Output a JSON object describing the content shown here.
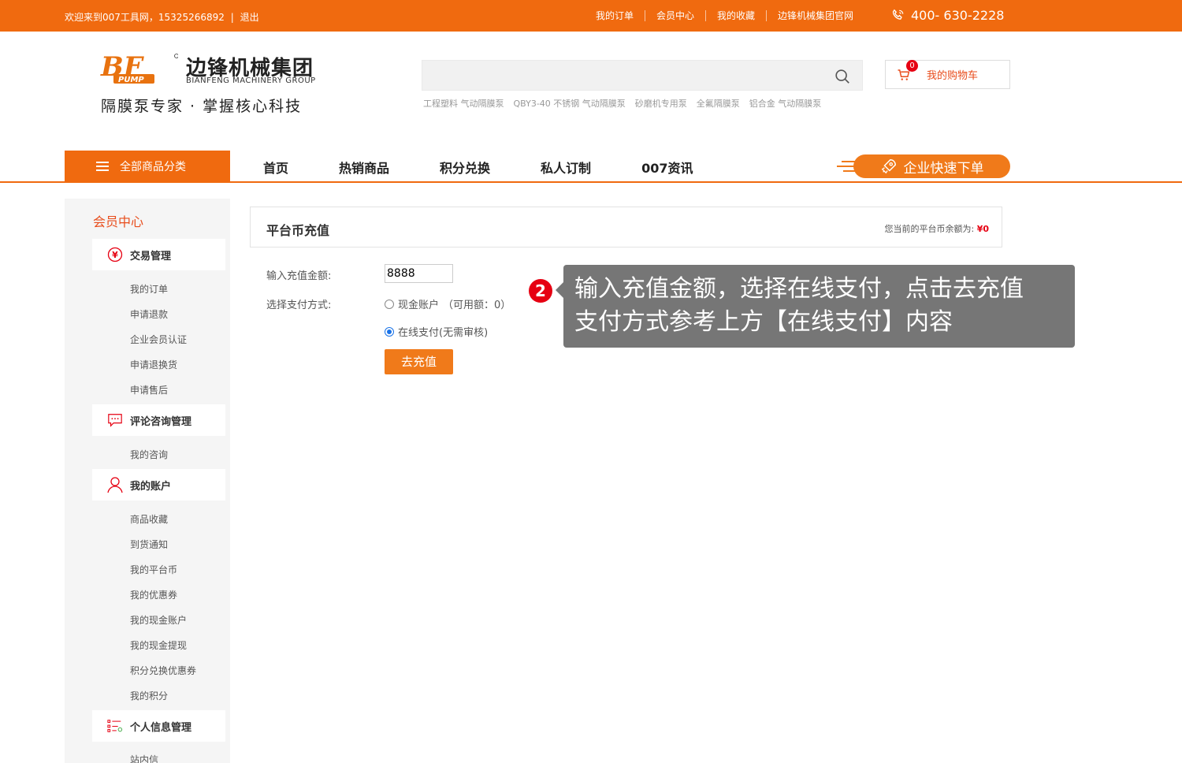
{
  "topbar": {
    "welcome": "欢迎来到007工具网，15325266892",
    "divider": "|",
    "logout": "退出",
    "links": [
      "我的订单",
      "会员中心",
      "我的收藏",
      "边锋机械集团官网"
    ],
    "phone": "400- 630-2228"
  },
  "logo": {
    "mark": "BF",
    "mark_sub": "PUMP",
    "name_cn": "边锋机械集团",
    "name_en": "BIANFENG MACHINERY GROUP",
    "slogan": "隔膜泵专家 · 掌握核心科技"
  },
  "search": {
    "hotwords": [
      "工程塑料 气动隔膜泵",
      "QBY3-40 不锈钢 气动隔膜泵",
      "砂磨机专用泵",
      "全氟隔膜泵",
      "铝合金 气动隔膜泵"
    ]
  },
  "cart": {
    "count": "0",
    "label": "我的购物车"
  },
  "nav": {
    "all_categories": "全部商品分类",
    "items": [
      "首页",
      "热销商品",
      "积分兑换",
      "私人订制",
      "007资讯"
    ],
    "quick_order": "企业快速下单"
  },
  "sidebar": {
    "title": "会员中心",
    "groups": [
      {
        "label": "交易管理",
        "items": [
          "我的订单",
          "申请退款",
          "企业会员认证",
          "申请退换货",
          "申请售后"
        ]
      },
      {
        "label": "评论咨询管理",
        "items": [
          "我的咨询"
        ]
      },
      {
        "label": "我的账户",
        "items": [
          "商品收藏",
          "到货通知",
          "我的平台币",
          "我的优惠券",
          "我的现金账户",
          "我的现金提现",
          "积分兑换优惠券",
          "我的积分"
        ]
      },
      {
        "label": "个人信息管理",
        "items": [
          "站内信"
        ]
      }
    ]
  },
  "main": {
    "panel_title": "平台币充值",
    "balance_label": "您当前的平台币余额为:",
    "balance_value": "¥0",
    "amount_label": "输入充值金额:",
    "amount_value": "8888",
    "pay_label": "选择支付方式:",
    "option_cash": "现金账户",
    "option_cash_avail": "（可用额：0）",
    "option_online": "在线支付(无需审核)",
    "submit": "去充值"
  },
  "annotation": {
    "step": "2",
    "line1": "输入充值金额，选择在线支付，点击去充值",
    "line2": "支付方式参考上方【在线支付】内容"
  },
  "colors": {
    "brand": "#f06a0f",
    "accent_red": "#e60012"
  }
}
